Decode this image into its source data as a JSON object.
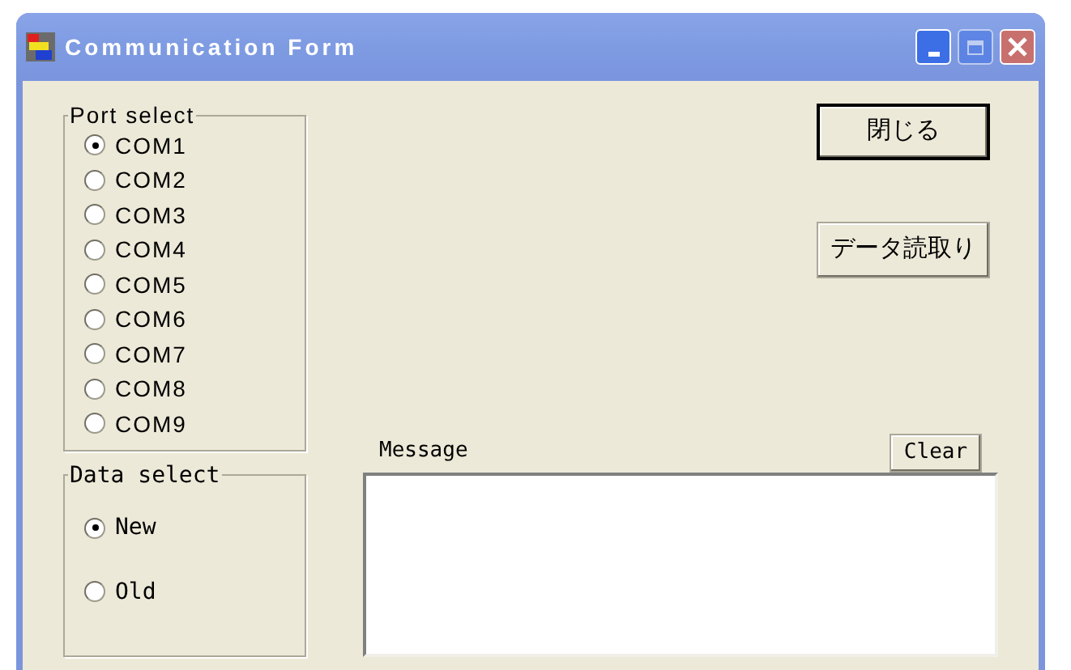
{
  "window": {
    "title": "Communication Form",
    "controls": [
      {
        "kind": "minimize",
        "disabled": false
      },
      {
        "kind": "maximize",
        "disabled": true
      },
      {
        "kind": "close",
        "disabled": false
      }
    ]
  },
  "port_select": {
    "legend": "Port select",
    "options": [
      {
        "label": "COM1",
        "selected": true
      },
      {
        "label": "COM2",
        "selected": false
      },
      {
        "label": "COM3",
        "selected": false
      },
      {
        "label": "COM4",
        "selected": false
      },
      {
        "label": "COM5",
        "selected": false
      },
      {
        "label": "COM6",
        "selected": false
      },
      {
        "label": "COM7",
        "selected": false
      },
      {
        "label": "COM8",
        "selected": false
      },
      {
        "label": "COM9",
        "selected": false
      }
    ]
  },
  "data_select": {
    "legend": "Data select",
    "options": [
      {
        "label": "New",
        "selected": true
      },
      {
        "label": "Old",
        "selected": false
      }
    ]
  },
  "buttons": [
    {
      "label": "閉じる",
      "default": true
    },
    {
      "label": "データ読取り",
      "default": false
    }
  ],
  "message": {
    "label": "Message",
    "clear_button": "Clear"
  }
}
